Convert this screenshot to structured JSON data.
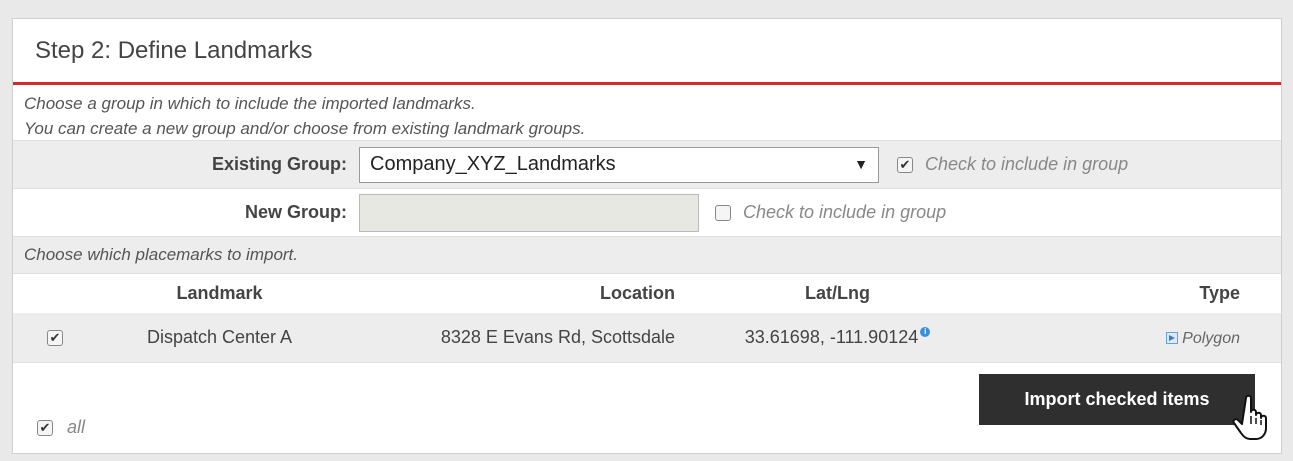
{
  "panel": {
    "title": "Step 2: Define Landmarks",
    "intro_line1": "Choose a group in which to include the imported landmarks.",
    "intro_line2": "You can create a new group and/or choose from existing landmark groups."
  },
  "existing_group": {
    "label": "Existing Group:",
    "selected": "Company_XYZ_Landmarks",
    "include_checked": true,
    "include_label": "Check to include in group"
  },
  "new_group": {
    "label": "New Group:",
    "value": "",
    "include_checked": false,
    "include_label": "Check to include in group"
  },
  "placemarks_note": "Choose which placemarks to import.",
  "table": {
    "headers": [
      "Landmark",
      "Location",
      "Lat/Lng",
      "Type"
    ],
    "rows": [
      {
        "checked": true,
        "landmark": "Dispatch Center A",
        "location": "8328 E Evans Rd, Scottsdale",
        "latlng": "33.61698, -111.90124",
        "type": "Polygon"
      }
    ]
  },
  "footer": {
    "all_checked": true,
    "all_label": "all",
    "import_button": "Import checked items"
  },
  "icons": [
    "chevron-down-icon",
    "checkbox-icon",
    "info-icon",
    "polygon-icon",
    "hand-cursor-icon"
  ],
  "colors": {
    "accent_line": "#d32a2a",
    "button_bg": "#2f2f2f",
    "info_blue": "#3b8fd9"
  }
}
